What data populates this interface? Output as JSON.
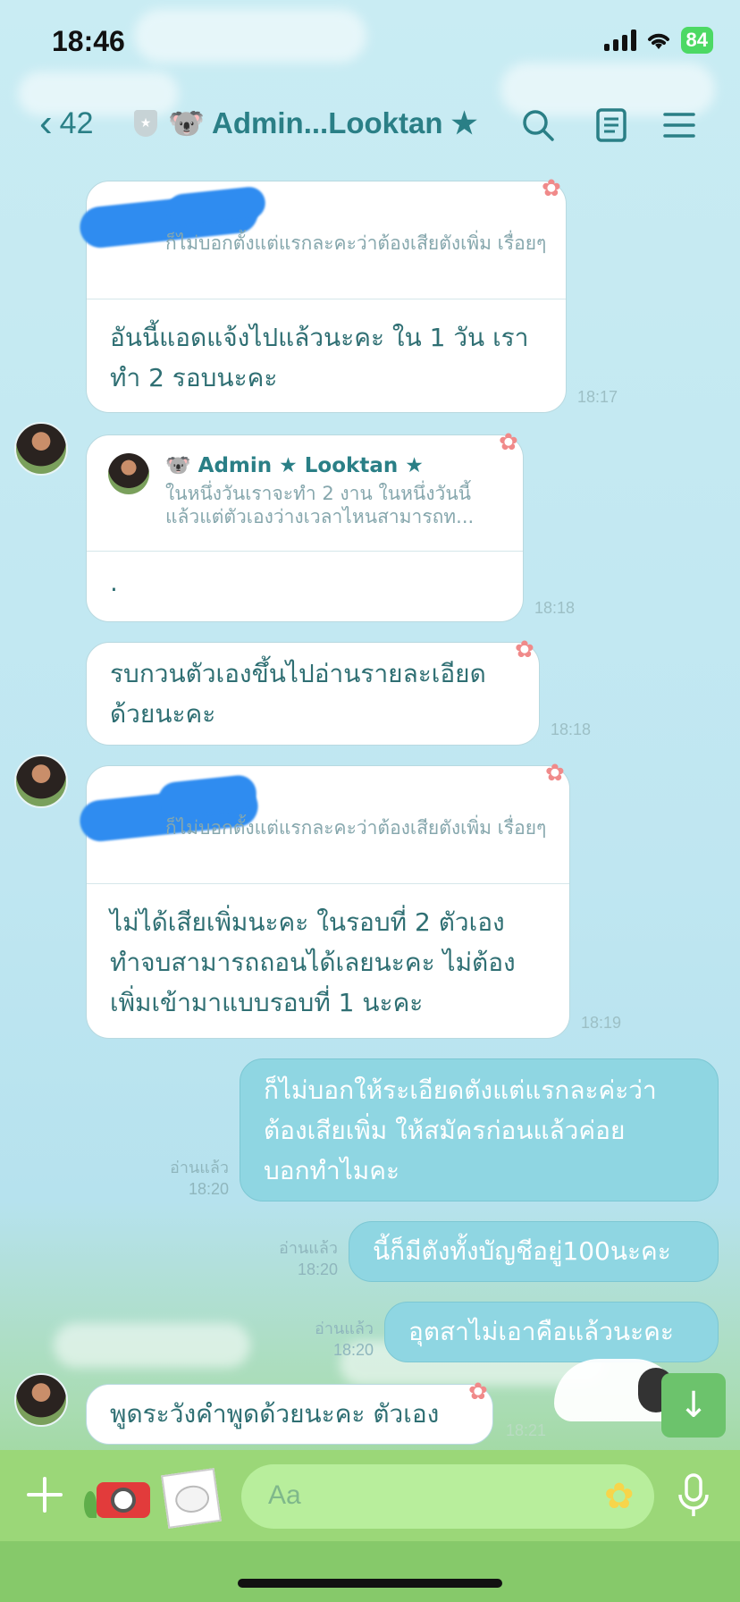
{
  "status": {
    "time": "18:46",
    "battery": "84"
  },
  "header": {
    "back_count": "42",
    "title": "🐨 Admin...Looktan ★"
  },
  "messages": [
    {
      "quote_text": "ก็ไม่บอกตั้งแต่แรกละคะว่าต้องเสียตังเพิ่ม เรื่อยๆ",
      "text_line1": "อันนี้แอดแจ้งไปแล้วนะคะ ใน 1 วัน เรา",
      "text_line2": "ทำ 2 รอบนะคะ",
      "time": "18:17"
    },
    {
      "quote_name": "🐨 Admin ★ Looktan ★",
      "quote_line1": "ในหนึ่งวันเราจะทำ 2 งาน ในหนึ่งวันนี้",
      "quote_line2": "แล้วแต่ตัวเองว่างเวลาไหนสามารถท...",
      "text": ".",
      "time": "18:18"
    },
    {
      "text_line1": "รบกวนตัวเองขึ้นไปอ่านรายละเอียด",
      "text_line2": "ด้วยนะคะ",
      "time": "18:18"
    },
    {
      "quote_text": "ก็ไม่บอกตั้งแต่แรกละคะว่าต้องเสียตังเพิ่ม เรื่อยๆ",
      "text_line1": "ไม่ได้เสียเพิ่มนะคะ ในรอบที่ 2 ตัวเอง",
      "text_line2": "ทำจบสามารถถอนได้เลยนะคะ ไม่ต้อง",
      "text_line3": "เพิ่มเข้ามาแบบรอบที่ 1 นะคะ",
      "time": "18:19"
    },
    {
      "text_line1": "ก็ไม่บอกให้ระเอียดตังแต่แรกละค่ะว่า",
      "text_line2": "ต้องเสียเพิ่ม ให้สมัครก่อนแล้วค่อย",
      "text_line3": "บอกทำไมคะ",
      "read": "อ่านแล้ว",
      "time": "18:20"
    },
    {
      "text": "นี้ก็มีตังทั้งบัญชีอยู่100นะคะ",
      "read": "อ่านแล้ว",
      "time": "18:20"
    },
    {
      "text": "อุตสาไม่เอาคือแล้วนะคะ",
      "read": "อ่านแล้ว",
      "time": "18:20"
    },
    {
      "text": "พูดระวังคำพูดด้วยนะคะ ตัวเอง",
      "time": "18:21"
    }
  ],
  "input": {
    "placeholder": "Aa"
  },
  "icons": [
    "back-chevron-icon",
    "shield-icon",
    "search-icon",
    "notes-icon",
    "menu-icon",
    "plus-icon",
    "camera-icon",
    "image-icon",
    "emoji-icon",
    "mic-icon",
    "arrow-down-icon"
  ]
}
